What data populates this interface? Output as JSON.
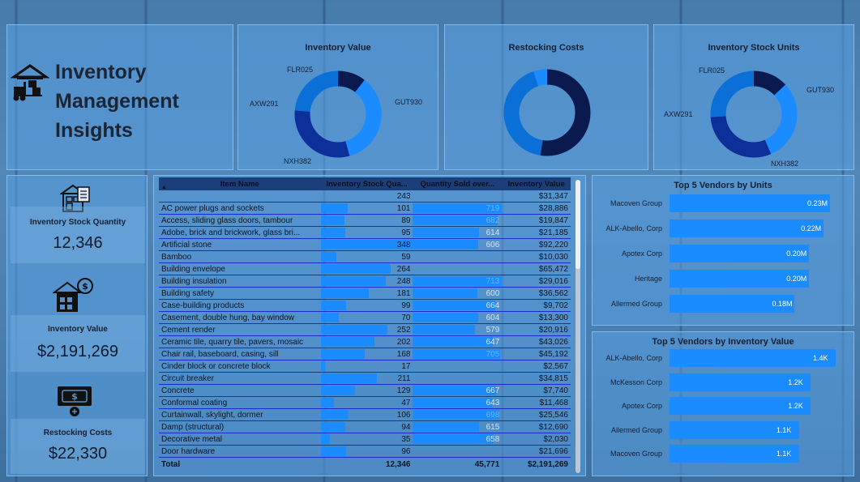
{
  "header": {
    "title_line1": "Inventory",
    "title_line2": "Management",
    "title_line3": "Insights",
    "icon": "warehouse-forklift-icon"
  },
  "kpis": [
    {
      "label": "Inventory Stock Quantity",
      "value": "12,346",
      "icon": "warehouse-checklist-icon"
    },
    {
      "label": "Inventory Value",
      "value": "$2,191,269",
      "icon": "warehouse-dollar-icon"
    },
    {
      "label": "Restocking Costs",
      "value": "$22,330",
      "icon": "cash-icon"
    }
  ],
  "charts": {
    "inventory_value": {
      "title": "Inventory Value",
      "labels": [
        "FLR025",
        "GUT930",
        "NXH382",
        "AXW291"
      ]
    },
    "restocking_costs": {
      "title": "Restocking Costs"
    },
    "inventory_units": {
      "title": "Inventory Stock Units",
      "labels": [
        "FLR025",
        "GUT930",
        "NXH382",
        "AXW291"
      ]
    }
  },
  "table": {
    "columns": [
      "Item Name",
      "Inventory Stock Qua...",
      "Quantity Sold over...",
      "Inventory Value"
    ],
    "rows": [
      {
        "name": "",
        "stock": "243",
        "sold": "",
        "value": "$31,347",
        "stock_frac": 0.0,
        "sold_frac": 0.0
      },
      {
        "name": "AC power plugs and sockets",
        "stock": "101",
        "sold": "719",
        "value": "$28,886",
        "stock_frac": 0.29,
        "sold_frac": 1.0
      },
      {
        "name": "Access, sliding glass doors, tambour",
        "stock": "89",
        "sold": "682",
        "value": "$19,847",
        "stock_frac": 0.26,
        "sold_frac": 0.95
      },
      {
        "name": "Adobe, brick and brickwork, glass bri...",
        "stock": "95",
        "sold": "614",
        "value": "$21,185",
        "stock_frac": 0.27,
        "sold_frac": 0.74
      },
      {
        "name": "Artificial stone",
        "stock": "348",
        "sold": "606",
        "value": "$92,220",
        "stock_frac": 1.0,
        "sold_frac": 0.73
      },
      {
        "name": "Bamboo",
        "stock": "59",
        "sold": "",
        "value": "$10,030",
        "stock_frac": 0.17,
        "sold_frac": 0.0
      },
      {
        "name": "Building envelope",
        "stock": "264",
        "sold": "",
        "value": "$65,472",
        "stock_frac": 0.76,
        "sold_frac": 0.0
      },
      {
        "name": "Building insulation",
        "stock": "248",
        "sold": "713",
        "value": "$29,016",
        "stock_frac": 0.71,
        "sold_frac": 1.0
      },
      {
        "name": "Building safety",
        "stock": "181",
        "sold": "600",
        "value": "$36,562",
        "stock_frac": 0.52,
        "sold_frac": 0.72
      },
      {
        "name": "Case-building products",
        "stock": "99",
        "sold": "664",
        "value": "$9,702",
        "stock_frac": 0.28,
        "sold_frac": 0.92
      },
      {
        "name": "Casement, double hung, bay window",
        "stock": "70",
        "sold": "604",
        "value": "$13,300",
        "stock_frac": 0.2,
        "sold_frac": 0.73
      },
      {
        "name": "Cement render",
        "stock": "252",
        "sold": "579",
        "value": "$20,916",
        "stock_frac": 0.72,
        "sold_frac": 0.7
      },
      {
        "name": "Ceramic tile, quarry tile, pavers, mosaic",
        "stock": "202",
        "sold": "647",
        "value": "$43,026",
        "stock_frac": 0.58,
        "sold_frac": 0.9
      },
      {
        "name": "Chair rail, baseboard, casing, sill",
        "stock": "168",
        "sold": "705",
        "value": "$45,192",
        "stock_frac": 0.48,
        "sold_frac": 0.98
      },
      {
        "name": "Cinder block or concrete block",
        "stock": "17",
        "sold": "",
        "value": "$2,567",
        "stock_frac": 0.05,
        "sold_frac": 0.0
      },
      {
        "name": "Circuit breaker",
        "stock": "211",
        "sold": "",
        "value": "$34,815",
        "stock_frac": 0.61,
        "sold_frac": 0.0
      },
      {
        "name": "Concrete",
        "stock": "129",
        "sold": "667",
        "value": "$7,740",
        "stock_frac": 0.37,
        "sold_frac": 0.93
      },
      {
        "name": "Conformal coating",
        "stock": "47",
        "sold": "643",
        "value": "$11,468",
        "stock_frac": 0.14,
        "sold_frac": 0.89
      },
      {
        "name": "Curtainwall, skylight, dormer",
        "stock": "106",
        "sold": "698",
        "value": "$25,546",
        "stock_frac": 0.3,
        "sold_frac": 0.97
      },
      {
        "name": "Damp (structural)",
        "stock": "94",
        "sold": "615",
        "value": "$12,690",
        "stock_frac": 0.27,
        "sold_frac": 0.74
      },
      {
        "name": "Decorative metal",
        "stock": "35",
        "sold": "658",
        "value": "$2,030",
        "stock_frac": 0.1,
        "sold_frac": 0.91
      },
      {
        "name": "Door hardware",
        "stock": "96",
        "sold": "",
        "value": "$21,696",
        "stock_frac": 0.28,
        "sold_frac": 0.0
      }
    ],
    "total": {
      "label": "Total",
      "stock": "12,346",
      "sold": "45,771",
      "value": "$2,191,269"
    }
  },
  "vendors_units": {
    "title": "Top 5 Vendors by Units",
    "items": [
      {
        "name": "Macoven Group",
        "value": "0.23M",
        "frac": 1.0
      },
      {
        "name": "ALK-Abello, Corp",
        "value": "0.22M",
        "frac": 0.96
      },
      {
        "name": "Apotex Corp",
        "value": "0.20M",
        "frac": 0.87
      },
      {
        "name": "Heritage",
        "value": "0.20M",
        "frac": 0.87
      },
      {
        "name": "Allermed Group",
        "value": "0.18M",
        "frac": 0.78
      }
    ]
  },
  "vendors_value": {
    "title": "Top 5 Vendors by Inventory Value",
    "items": [
      {
        "name": "ALK-Abello, Corp",
        "value": "1.4K",
        "frac": 1.0
      },
      {
        "name": "McKesson Corp",
        "value": "1.2K",
        "frac": 0.85
      },
      {
        "name": "Apotex Corp",
        "value": "1.2K",
        "frac": 0.85
      },
      {
        "name": "Allermed Group",
        "value": "1.1K",
        "frac": 0.78
      },
      {
        "name": "Macoven Group",
        "value": "1.1K",
        "frac": 0.78
      }
    ]
  },
  "colors": {
    "accent": "#1a8cff",
    "navy": "#0a1a4f",
    "dark_blue": "#0c2f9a",
    "mid_blue": "#0a6fd6",
    "light_blue": "#1a8cff"
  }
}
